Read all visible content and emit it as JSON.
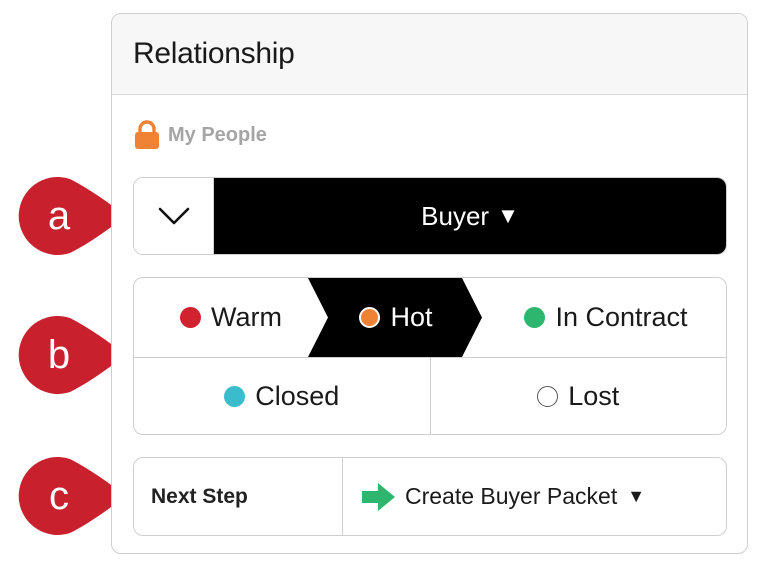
{
  "card": {
    "title": "Relationship"
  },
  "privacy": {
    "icon": "lock-icon",
    "label": "My People",
    "icon_color": "#f08236"
  },
  "type_row": {
    "selected": "Buyer"
  },
  "status": {
    "options": [
      {
        "label": "Warm",
        "color": "#d0232f",
        "active": false
      },
      {
        "label": "Hot",
        "color": "#f08236",
        "active": true
      },
      {
        "label": "In Contract",
        "color": "#2fb66e",
        "active": false
      },
      {
        "label": "Closed",
        "color": "#3bbccc",
        "active": false
      },
      {
        "label": "Lost",
        "color": "#ffffff",
        "active": false
      }
    ]
  },
  "next_step": {
    "label": "Next Step",
    "action": "Create Buyer Packet",
    "arrow_color": "#2fb66e"
  },
  "markers": {
    "a1": "a",
    "b": "b",
    "a2": "c",
    "color": "#c8202c"
  },
  "dropdown_glyph": "▼"
}
